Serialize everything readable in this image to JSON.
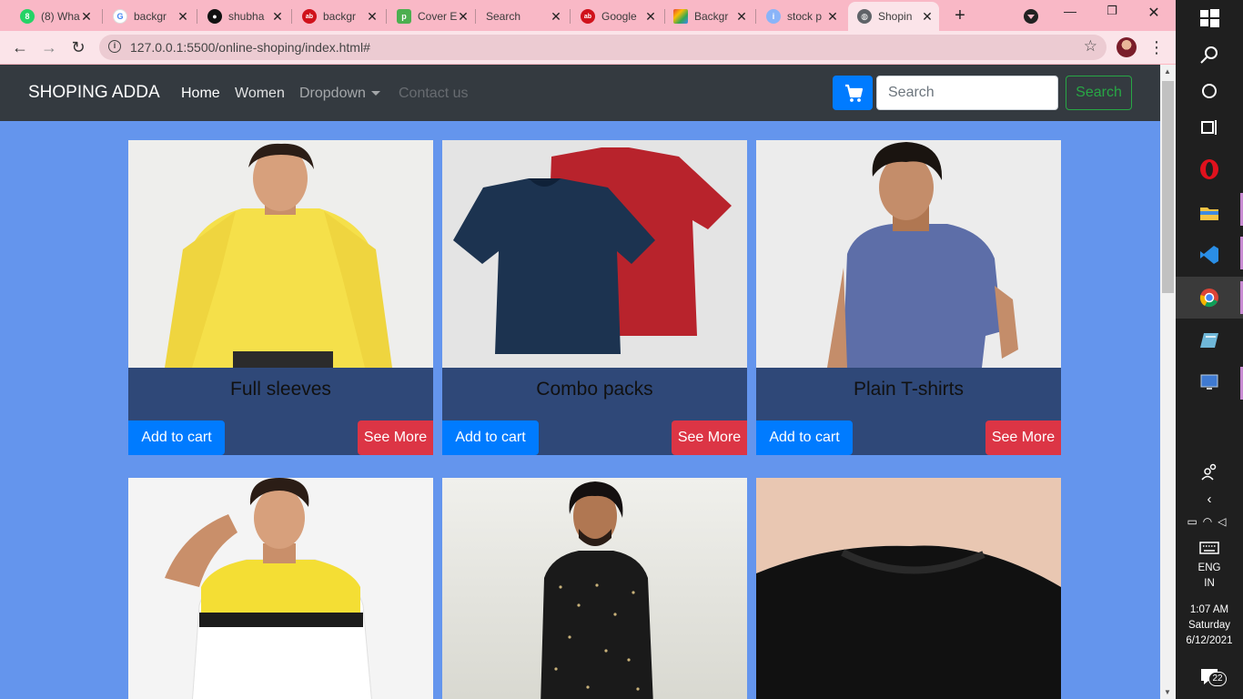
{
  "browser": {
    "tabs": [
      {
        "label": "(8) Wha",
        "fav_color": "#25d366",
        "fav_glyph": "8"
      },
      {
        "label": "backgr",
        "fav_color": "#ffffff",
        "fav_glyph": "G"
      },
      {
        "label": "shubha",
        "fav_color": "#111111",
        "fav_glyph": "◉"
      },
      {
        "label": "backgr",
        "fav_color": "#d0121b",
        "fav_glyph": "ab"
      },
      {
        "label": "Cover E",
        "fav_color": "#4caf50",
        "fav_glyph": "p"
      },
      {
        "label": "Search",
        "fav_color": "",
        "fav_glyph": ""
      },
      {
        "label": "Google",
        "fav_color": "#d0121b",
        "fav_glyph": "ab"
      },
      {
        "label": "Backgr",
        "fav_color": "#f4b400",
        "fav_glyph": "◆"
      },
      {
        "label": "stock p",
        "fav_color": "#8ab4f8",
        "fav_glyph": "i"
      },
      {
        "label": "Shopin",
        "fav_color": "#5f6368",
        "fav_glyph": "◍",
        "active": true
      }
    ],
    "url": "127.0.0.1:5500/online-shoping/index.html#"
  },
  "navbar": {
    "brand": "SHOPING ADDA",
    "links": [
      "Home",
      "Women",
      "Dropdown",
      "Contact us"
    ],
    "search_placeholder": "Search",
    "search_button": "Search",
    "cart_icon": "cart-icon"
  },
  "cards": [
    {
      "title": "Full sleeves",
      "add_label": "Add to cart",
      "more_label": "See More",
      "image": "man-yellow-full-sleeve"
    },
    {
      "title": "Combo packs",
      "add_label": "Add to cart",
      "more_label": "See More",
      "image": "navy-red-tshirt-combo"
    },
    {
      "title": "Plain T-shirts",
      "add_label": "Add to cart",
      "more_label": "See More",
      "image": "man-blue-tshirt"
    },
    {
      "title": "",
      "image": "man-yellow-polo"
    },
    {
      "title": "",
      "image": "man-black-kurta"
    },
    {
      "title": "",
      "image": "man-black-tshirt"
    }
  ],
  "taskbar": {
    "lang1": "ENG",
    "lang2": "IN",
    "time": "1:07 AM",
    "day": "Saturday",
    "date": "6/12/2021",
    "notifications": "22"
  },
  "colors": {
    "page_bg": "#6495ed",
    "navbar_bg": "#343a40",
    "card_body": "#2f4878",
    "primary": "#007bff",
    "danger": "#dc3545",
    "success": "#28a745"
  }
}
